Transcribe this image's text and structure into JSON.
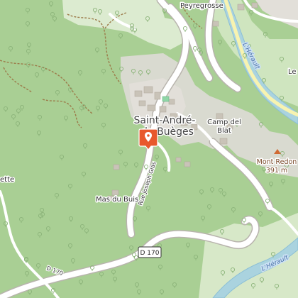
{
  "map": {
    "labels": {
      "town_line1": "Saint-André-",
      "town_line2": "de-Buèges",
      "peyregrosse": "Peyregrosse",
      "camp_line1": "Camp del",
      "camp_line2": "Blat",
      "mont_redon": "Mont Redon",
      "mont_redon_alt": "391 m",
      "mas_du_buis": "Mas du Buis",
      "ette": "ette",
      "le": "Le",
      "rue_joseph_glas": "Rue Joseph Glas",
      "d170": "D 170",
      "d170_left": "D 170",
      "herault_top": "L'Hérault",
      "herault_bottom": "L'Hérault"
    },
    "marker": {
      "icon": "location-pin-icon",
      "color": "#e8582c"
    },
    "colors": {
      "forest": "#a9cf94",
      "urban": "#e2dfd9",
      "water": "#aad3df",
      "road": "#ffffff",
      "track": "#9c7b4a"
    }
  }
}
